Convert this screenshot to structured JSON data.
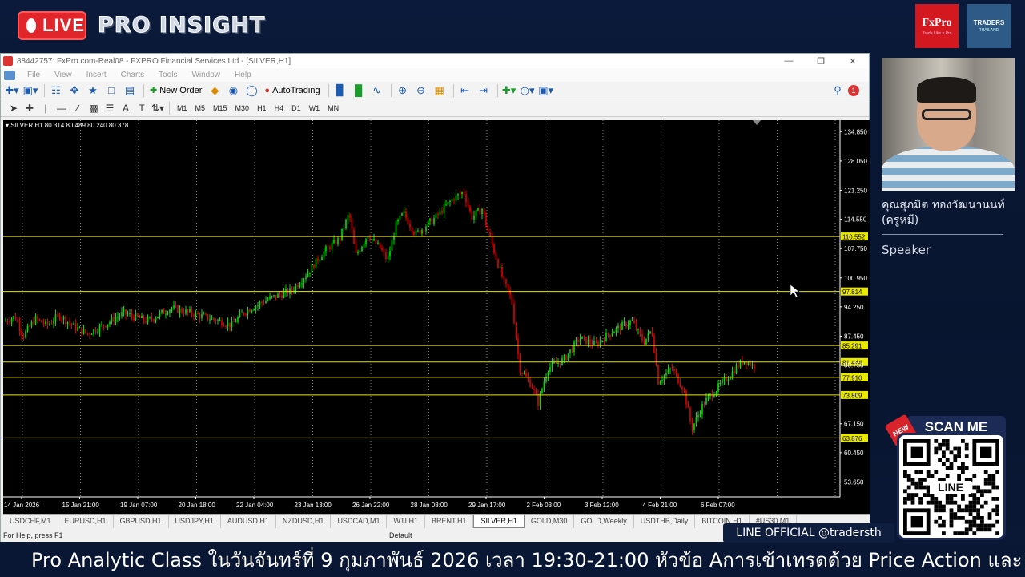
{
  "overlay": {
    "live_label": "LIVE",
    "brand_title": "PRO INSIGHT",
    "logos": [
      {
        "name": "FxPro",
        "tagline": "Trade Like a Pro"
      },
      {
        "name": "TRADERS",
        "tagline": "THAILAND"
      }
    ],
    "speaker": {
      "name": "คุณสุภมิต ทองวัฒนานนท์ (ครูหมี)",
      "role": "Speaker"
    },
    "scan": {
      "label": "SCAN ME",
      "badge": "NEW",
      "qr_text": "LINE"
    },
    "line_official": "LINE OFFICIAL @tradersth",
    "ticker": "Pro Analytic Class ในวันจันทร์ที่ 9 กุมภาพันธ์ 2026 เวลา 19:30-21:00 หัวข้อ Aการเข้าเทรดด้วย Price Action และ"
  },
  "terminal": {
    "title": "88442757: FxPro.com-Real08 - FXPRO Financial Services Ltd - [SILVER,H1]",
    "menu": [
      "File",
      "View",
      "Insert",
      "Charts",
      "Tools",
      "Window",
      "Help"
    ],
    "toolbar": {
      "new_order": "New Order",
      "autotrading": "AutoTrading"
    },
    "timeframes": [
      "M1",
      "M5",
      "M15",
      "M30",
      "H1",
      "H4",
      "D1",
      "W1",
      "MN"
    ],
    "chart_header": "SILVER,H1  80.314 80.489 80.240 80.378",
    "tabs": [
      "USDCHF,M1",
      "EURUSD,H1",
      "GBPUSD,H1",
      "USDJPY,H1",
      "AUDUSD,H1",
      "NZDUSD,H1",
      "USDCAD,M1",
      "WTI,H1",
      "BRENT,H1",
      "SILVER,H1",
      "GOLD,M30",
      "GOLD,Weekly",
      "USDTHB,Daily",
      "BITCOIN,H1",
      "#US30,M1"
    ],
    "active_tab": "SILVER,H1",
    "status": {
      "help": "For Help, press F1",
      "profile": "Default"
    }
  },
  "chart_data": {
    "type": "candlestick",
    "symbol": "SILVER",
    "timeframe": "H1",
    "ylim": [
      50.2,
      137.5
    ],
    "price_ticks": [
      134.85,
      128.05,
      121.25,
      114.55,
      107.75,
      100.95,
      94.25,
      87.45,
      80.75,
      67.15,
      60.45,
      53.65
    ],
    "x_labels": [
      "14 Jan 2026",
      "15 Jan 21:00",
      "19 Jan 07:00",
      "20 Jan 18:00",
      "22 Jan 04:00",
      "23 Jan 13:00",
      "26 Jan 22:00",
      "28 Jan 08:00",
      "29 Jan 17:00",
      "2 Feb 03:00",
      "3 Feb 12:00",
      "4 Feb 21:00",
      "6 Feb 07:00"
    ],
    "horizontal_levels": [
      110.552,
      97.814,
      85.291,
      81.444,
      77.91,
      73.809,
      63.876
    ],
    "level_color": "#e8e800",
    "bull_color": "#00e000",
    "bear_color": "#e00000",
    "close_anchors": [
      [
        0,
        90.8
      ],
      [
        15,
        92.0
      ],
      [
        25,
        87.5
      ],
      [
        40,
        91.5
      ],
      [
        55,
        90.0
      ],
      [
        70,
        92.3
      ],
      [
        90,
        89.5
      ],
      [
        105,
        88.0
      ],
      [
        130,
        90.5
      ],
      [
        150,
        92.8
      ],
      [
        180,
        91.0
      ],
      [
        210,
        94.0
      ],
      [
        240,
        92.5
      ],
      [
        270,
        91.0
      ],
      [
        285,
        90.0
      ],
      [
        300,
        93.0
      ],
      [
        330,
        96.0
      ],
      [
        360,
        98.0
      ],
      [
        380,
        102.0
      ],
      [
        400,
        107.0
      ],
      [
        420,
        110.0
      ],
      [
        432,
        116.0
      ],
      [
        440,
        106.0
      ],
      [
        455,
        111.0
      ],
      [
        470,
        108.0
      ],
      [
        480,
        105.0
      ],
      [
        490,
        113.0
      ],
      [
        500,
        116.0
      ],
      [
        515,
        111.0
      ],
      [
        540,
        115.0
      ],
      [
        560,
        119.0
      ],
      [
        575,
        121.0
      ],
      [
        585,
        115.0
      ],
      [
        598,
        117.0
      ],
      [
        605,
        112.0
      ],
      [
        625,
        100.0
      ],
      [
        635,
        96.0
      ],
      [
        645,
        80.0
      ],
      [
        660,
        76.0
      ],
      [
        668,
        72.0
      ],
      [
        680,
        80.0
      ],
      [
        700,
        82.0
      ],
      [
        720,
        87.0
      ],
      [
        740,
        85.5
      ],
      [
        760,
        88.5
      ],
      [
        785,
        91.0
      ],
      [
        800,
        86.0
      ],
      [
        810,
        89.0
      ],
      [
        818,
        77.0
      ],
      [
        835,
        80.0
      ],
      [
        850,
        75.0
      ],
      [
        860,
        66.0
      ],
      [
        875,
        72.0
      ],
      [
        890,
        75.0
      ],
      [
        910,
        79.0
      ],
      [
        925,
        82.0
      ],
      [
        938,
        80.4
      ]
    ]
  }
}
